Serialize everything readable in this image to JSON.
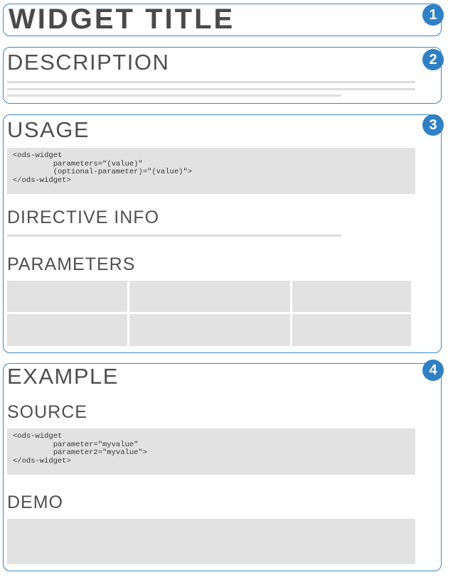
{
  "widget_title": "WIDGET TITLE",
  "badges": [
    "1",
    "2",
    "3",
    "4"
  ],
  "description": {
    "heading": "DESCRIPTION"
  },
  "usage": {
    "heading": "USAGE",
    "code_lines": [
      "<ods-widget",
      "         parameters=\"(value)\"",
      "         (optional-parameter)=\"(value)\">",
      "</ods-widget>"
    ],
    "directive_heading": "DIRECTIVE INFO",
    "parameters_heading": "PARAMETERS"
  },
  "example": {
    "heading": "EXAMPLE",
    "source_heading": "SOURCE",
    "code_lines": [
      "<ods-widget",
      "         parameter=\"myvalue\"",
      "         parameter2=\"myvalue\">",
      "</ods-widget>"
    ],
    "demo_heading": "DEMO"
  },
  "colors": {
    "accent": "#2f80c4",
    "placeholder": "#e2e2e2",
    "text": "#4a4a4a"
  }
}
